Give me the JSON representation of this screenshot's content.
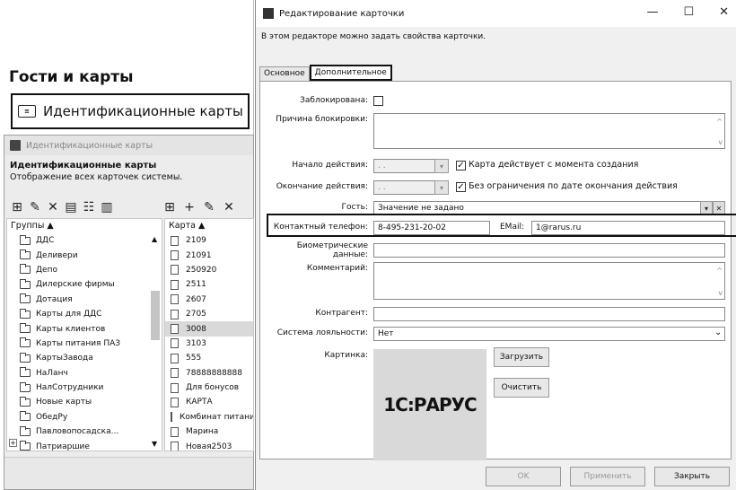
{
  "left": {
    "page_title": "Гости и карты",
    "id_cards_link": "Идентификационные карты",
    "id_cards_icon": "id-card-icon",
    "window_title": "Идентификационные карты",
    "header_title": "Идентификационные карты",
    "header_subtitle": "Отображение всех карточек системы.",
    "groups_header": "Группы ▲",
    "cards_header": "Карта ▲",
    "groups": [
      "ДДС",
      "Деливери",
      "Депо",
      "Дилерские фирмы",
      "Дотация",
      "Карты для ДДС",
      "Карты клиентов",
      "Карты питания ПАЗ",
      "КартыЗавода",
      "НаЛанч",
      "НалСотрудники",
      "Новые карты",
      "ОбедРу",
      "Павловопосадска...",
      "Патриаршие"
    ],
    "cards": [
      "2109",
      "21091",
      "250920",
      "2511",
      "2607",
      "2705",
      "3008",
      "3103",
      "555",
      "78888888888",
      "Для бонусов",
      "КАРТА",
      "Комбинат питани",
      "Марина",
      "Новая2503"
    ],
    "selected_card": "3008"
  },
  "dialog": {
    "title": "Редактирование карточки",
    "description": "В этом редакторе можно задать свойства карточки.",
    "tabs": [
      "Основное",
      "Дополнительное"
    ],
    "active_tab": "Дополнительное",
    "fields": {
      "blocked_label": "Заблокирована:",
      "block_reason_label": "Причина блокировки:",
      "start_label": "Начало действия:",
      "start_value": ". .",
      "start_check_label": "Карта действует с момента создания",
      "end_label": "Окончание действия:",
      "end_value": ". .",
      "end_check_label": "Без ограничения по дате окончания действия",
      "guest_label": "Гость:",
      "guest_value": "Значение не задано",
      "phone_label": "Контактный телефон:",
      "phone_value": "8-495-231-20-02",
      "email_label": "EMail:",
      "email_value": "1@rarus.ru",
      "biometric_label": "Биометрические данные:",
      "comment_label": "Комментарий:",
      "counterparty_label": "Контрагент:",
      "loyalty_label": "Система лояльности:",
      "loyalty_value": "Нет",
      "picture_label": "Картинка:",
      "load_button": "Загрузить",
      "clear_button": "Очистить",
      "logo_text": "1С:РАРУС"
    },
    "footer": {
      "ok": "OK",
      "apply": "Применить",
      "close": "Закрыть"
    }
  }
}
